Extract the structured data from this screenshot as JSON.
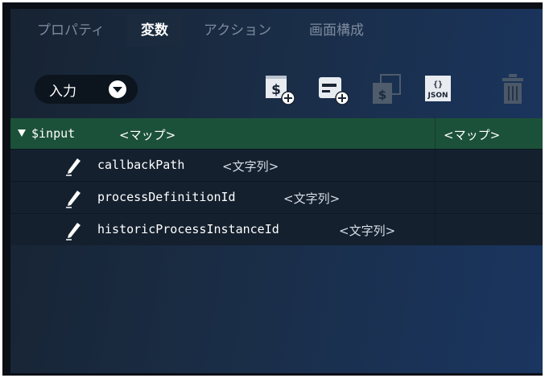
{
  "tabs": [
    {
      "label": "プロパティ",
      "active": false
    },
    {
      "label": "変数",
      "active": true
    },
    {
      "label": "アクション",
      "active": false
    },
    {
      "label": "画面構成",
      "active": false
    }
  ],
  "toolbar": {
    "io_selector": {
      "label": "入力",
      "icon": "chevron-down-icon"
    },
    "buttons": [
      {
        "icon": "add-variable-icon",
        "label": "$",
        "enabled": true
      },
      {
        "icon": "add-card-icon",
        "label": "",
        "enabled": true
      },
      {
        "icon": "copy-variable-icon",
        "label": "$",
        "enabled": false
      },
      {
        "icon": "json-icon",
        "label": "{}\nJSON",
        "enabled": true
      },
      {
        "icon": "trash-icon",
        "label": "",
        "enabled": false
      }
    ]
  },
  "tree": {
    "root": {
      "name": "$input",
      "type": "<マップ>",
      "value_type": "<マップ>"
    },
    "children": [
      {
        "name": "callbackPath",
        "type": "<文字列>"
      },
      {
        "name": "processDefinitionId",
        "type": "<文字列>"
      },
      {
        "name": "historicProcessInstanceId",
        "type": "<文字列>"
      }
    ]
  },
  "colors": {
    "panel": "#1a2d46",
    "tree_root_row": "#1c5139",
    "tree_child_row": "#14202e",
    "text": "#ffffff",
    "muted_tab": "#7d8a9c"
  }
}
